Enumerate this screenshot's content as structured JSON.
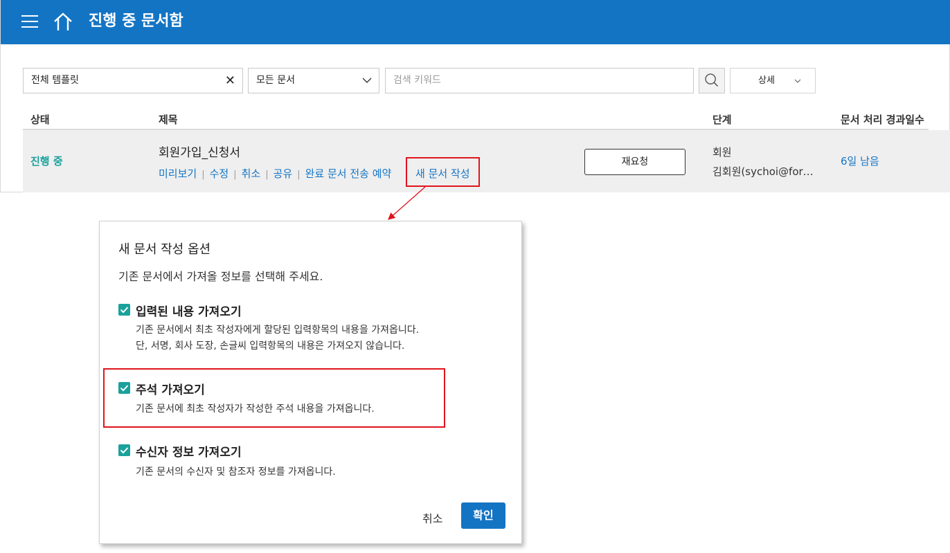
{
  "header": {
    "title": "진행 중 문서함"
  },
  "filters": {
    "template_value": "전체 템플릿",
    "clear_symbol": "✕",
    "doc_type_value": "모든 문서",
    "search_placeholder": "검색 키워드",
    "detail_label": "상세"
  },
  "table": {
    "columns": {
      "status": "상태",
      "title": "제목",
      "step": "단계",
      "days": "문서 처리 경과일수"
    },
    "row": {
      "status": "진행 중",
      "title": "회원가입_신청서",
      "actions": [
        "미리보기",
        "수정",
        "취소",
        "공유",
        "완료 문서 전송 예약"
      ],
      "separator": "|",
      "new_doc_label": "새 문서 작성",
      "rerequest_label": "재요청",
      "step_name": "회원",
      "step_user": "김회원(sychoi@for…",
      "days_left": "6일 남음"
    }
  },
  "modal": {
    "title": "새 문서 작성 옵션",
    "description": "기존 문서에서 가져올 정보를 선택해 주세요.",
    "options": [
      {
        "label": "입력된 내용 가져오기",
        "checked": true,
        "desc": [
          "기존 문서에서 최초 작성자에게 할당된 입력항목의 내용을 가져옵니다.",
          "단, 서명, 회사 도장, 손글씨 입력항목의 내용은 가져오지 않습니다."
        ]
      },
      {
        "label": "주석 가져오기",
        "checked": true,
        "desc": [
          "기존 문서에 최초 작성자가 작성한 주석 내용을 가져옵니다."
        ]
      },
      {
        "label": "수신자 정보 가져오기",
        "checked": true,
        "desc": [
          "기존 문서의 수신자 및 참조자 정보를 가져옵니다."
        ]
      }
    ],
    "cancel_label": "취소",
    "ok_label": "확인"
  },
  "colors": {
    "brand": "#1474c4",
    "accent_teal": "#1aa19b",
    "highlight_red": "#e0141c"
  },
  "icons": [
    "menu-icon",
    "home-icon",
    "clear-icon",
    "chevron-down-icon",
    "search-icon",
    "check-icon"
  ]
}
